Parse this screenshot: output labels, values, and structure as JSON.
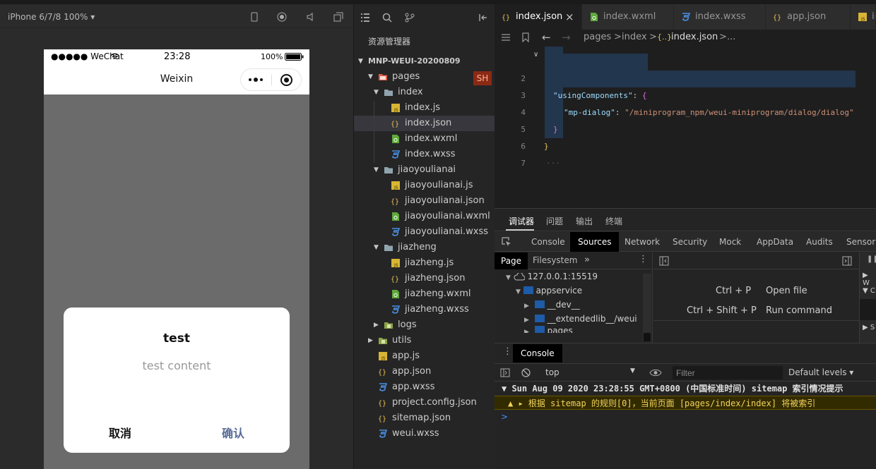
{
  "simulator": {
    "device_label": "iPhone 6/7/8 100%",
    "status_bar": {
      "signal": "●●●●● WeChat",
      "time": "23:28",
      "battery": "100%"
    },
    "nav_title": "Weixin",
    "dialog": {
      "title": "test",
      "content": "test content",
      "cancel": "取消",
      "confirm": "确认"
    }
  },
  "explorer": {
    "title": "资源管理器",
    "project": "MNP-WEUI-20200809",
    "badge": "SH",
    "tree": [
      {
        "label": "pages",
        "type": "folder-pages",
        "depth": 1,
        "arrow": "▼"
      },
      {
        "label": "index",
        "type": "folder",
        "depth": 2,
        "arrow": "▼"
      },
      {
        "label": "index.js",
        "type": "js",
        "depth": 3
      },
      {
        "label": "index.json",
        "type": "json",
        "depth": 3,
        "selected": true
      },
      {
        "label": "index.wxml",
        "type": "wxml",
        "depth": 3
      },
      {
        "label": "index.wxss",
        "type": "wxss",
        "depth": 3
      },
      {
        "label": "jiaoyoulianai",
        "type": "folder",
        "depth": 2,
        "arrow": "▼"
      },
      {
        "label": "jiaoyoulianai.js",
        "type": "js",
        "depth": 3
      },
      {
        "label": "jiaoyoulianai.json",
        "type": "json",
        "depth": 3
      },
      {
        "label": "jiaoyoulianai.wxml",
        "type": "wxml",
        "depth": 3
      },
      {
        "label": "jiaoyoulianai.wxss",
        "type": "wxss",
        "depth": 3
      },
      {
        "label": "jiazheng",
        "type": "folder",
        "depth": 2,
        "arrow": "▼"
      },
      {
        "label": "jiazheng.js",
        "type": "js",
        "depth": 3
      },
      {
        "label": "jiazheng.json",
        "type": "json",
        "depth": 3
      },
      {
        "label": "jiazheng.wxml",
        "type": "wxml",
        "depth": 3
      },
      {
        "label": "jiazheng.wxss",
        "type": "wxss",
        "depth": 3
      },
      {
        "label": "logs",
        "type": "folder-green",
        "depth": 2,
        "arrow": "▶"
      },
      {
        "label": "utils",
        "type": "folder-green",
        "depth": 1,
        "arrow": "▶"
      },
      {
        "label": "app.js",
        "type": "js",
        "depth": 1
      },
      {
        "label": "app.json",
        "type": "json",
        "depth": 1
      },
      {
        "label": "app.wxss",
        "type": "wxss",
        "depth": 1
      },
      {
        "label": "project.config.json",
        "type": "json",
        "depth": 1
      },
      {
        "label": "sitemap.json",
        "type": "json",
        "depth": 1
      },
      {
        "label": "weui.wxss",
        "type": "wxss",
        "depth": 1
      }
    ]
  },
  "editor": {
    "tabs": [
      {
        "label": "index.json",
        "type": "json",
        "active": true,
        "close": "×"
      },
      {
        "label": "index.wxml",
        "type": "wxml"
      },
      {
        "label": "index.wxss",
        "type": "wxss"
      },
      {
        "label": "app.json",
        "type": "json"
      },
      {
        "label": "in",
        "type": "js"
      }
    ],
    "breadcrumb": {
      "p1": "pages",
      "sep": ">",
      "p2": "index",
      "p3": "index.json",
      "more": "..."
    },
    "code": {
      "line2_key": "\"usingComponents\"",
      "line3_key": "\"mp-dialog\"",
      "line3_value": "\"/miniprogram_npm/weui-miniprogram/dialog/dialog\"",
      "open_brace": "{",
      "close_brace": "}",
      "colon": ":",
      "dots": "···"
    },
    "line_numbers": [
      "2",
      "3",
      "4",
      "5",
      "6",
      "7"
    ]
  },
  "devtools": {
    "top_tabs": [
      "调试器",
      "问题",
      "输出",
      "终端"
    ],
    "panel_tabs": [
      "Console",
      "Sources",
      "Network",
      "Security",
      "Mock",
      "AppData",
      "Audits",
      "Sensor"
    ],
    "active_panel": "Sources",
    "sources_subtabs": {
      "page": "Page",
      "filesystem": "Filesystem",
      "more": "»"
    },
    "source_tree": {
      "host": "127.0.0.1:15519",
      "appservice": "appservice",
      "dev": "__dev__",
      "extended": "__extendedlib__/weui",
      "pages": "pages"
    },
    "shortcuts": [
      {
        "keys": "Ctrl + P",
        "action": "Open file"
      },
      {
        "keys": "Ctrl + Shift + P",
        "action": "Run command"
      }
    ],
    "right_side": {
      "w": "W",
      "c": "C",
      "s": "S"
    },
    "console": {
      "drawer_tab": "Console",
      "context": "top",
      "filter_placeholder": "Filter",
      "levels": "Default levels ▾",
      "msg1": "▼ Sun Aug 09 2020 23:28:55 GMT+0800 (中国标准时间) sitemap 索引情况提示",
      "msg2": "▲ ▸ 根据 sitemap 的规则[0]，当前页面 [pages/index/index] 将被索引",
      "prompt": ">"
    }
  },
  "colors": {
    "accent_confirm": "#576b95",
    "warn_bg": "#332b00",
    "warn_text": "#f2d45c"
  }
}
